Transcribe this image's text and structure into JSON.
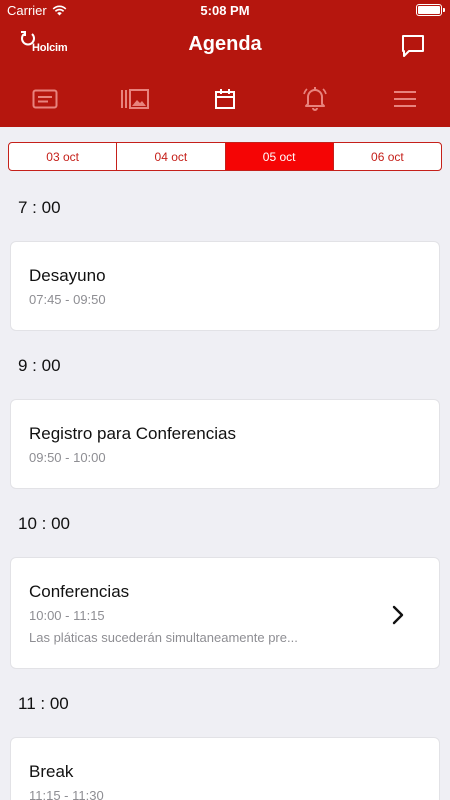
{
  "status_bar": {
    "carrier": "Carrier",
    "time": "5:08 PM"
  },
  "header": {
    "logo_text": "Holcim",
    "title": "Agenda"
  },
  "tabs": [
    {
      "icon": "id-card-icon",
      "active": false
    },
    {
      "icon": "gallery-icon",
      "active": false
    },
    {
      "icon": "calendar-icon",
      "active": true
    },
    {
      "icon": "bell-icon",
      "active": false
    },
    {
      "icon": "menu-icon",
      "active": false
    }
  ],
  "dates": [
    "03 oct",
    "04 oct",
    "05 oct",
    "06 oct"
  ],
  "selected_date": "05 oct",
  "agenda": [
    {
      "hour": "7 : 00",
      "items": [
        {
          "title": "Desayuno",
          "time": "07:45 - 09:50"
        }
      ]
    },
    {
      "hour": "9 : 00",
      "items": [
        {
          "title": "Registro para Conferencias",
          "time": "09:50 - 10:00"
        }
      ]
    },
    {
      "hour": "10 : 00",
      "items": [
        {
          "title": "Conferencias",
          "time": "10:00 - 11:15",
          "description": "Las pláticas sucederán simultaneamente pre..."
        }
      ]
    },
    {
      "hour": "11 : 00",
      "items": [
        {
          "title": "Break",
          "time": "11:15 - 11:30"
        }
      ]
    }
  ],
  "colors": {
    "header": "#b5160e",
    "accent": "#f50505",
    "tab_icon": "#e8837d",
    "background": "#efeff4"
  }
}
